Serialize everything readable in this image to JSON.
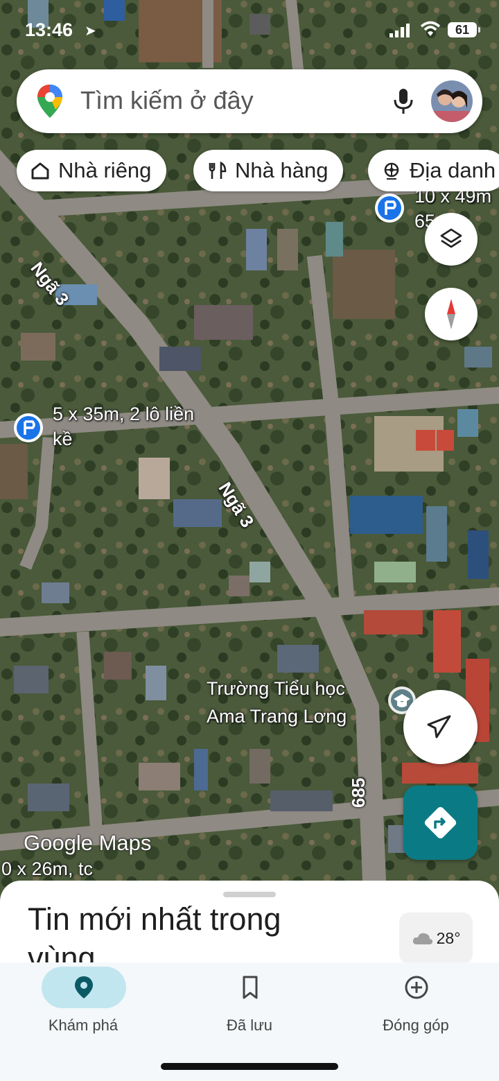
{
  "status_bar": {
    "time": "13:46",
    "battery": "61"
  },
  "search": {
    "placeholder": "Tìm kiếm ở đây"
  },
  "chips": [
    {
      "label": "Nhà riêng",
      "icon": "home-icon"
    },
    {
      "label": "Nhà hàng",
      "icon": "restaurant-icon"
    },
    {
      "label": "Địa danh",
      "icon": "landmark-icon"
    }
  ],
  "map": {
    "road_labels": [
      "Ngã 3",
      "Ngã 3",
      "685"
    ],
    "listings": [
      {
        "line1": "5 x 35m, 2 lô liền",
        "line2": "kề"
      },
      {
        "line1": "10 x 49m",
        "line2": "65"
      },
      {
        "line1": "0 x 26m, tc",
        "line2": ""
      }
    ],
    "poi": {
      "line1": "Trường Tiểu học",
      "line2": "Ama Trang Lơng",
      "icon": "school-icon"
    },
    "watermark": "Google Maps"
  },
  "sheet": {
    "title": "Tin mới nhất trong vùng",
    "temperature": "28°",
    "weather_icon": "cloud-icon"
  },
  "nav": [
    {
      "label": "Khám phá",
      "icon": "explore-pin-icon",
      "active": true
    },
    {
      "label": "Đã lưu",
      "icon": "bookmark-icon",
      "active": false
    },
    {
      "label": "Đóng góp",
      "icon": "add-circle-icon",
      "active": false
    }
  ],
  "colors": {
    "accent": "#0a7b85",
    "nav_active": "#c2e6f0",
    "compass_red": "#e53935",
    "listing_pin": "#1a73e8"
  }
}
